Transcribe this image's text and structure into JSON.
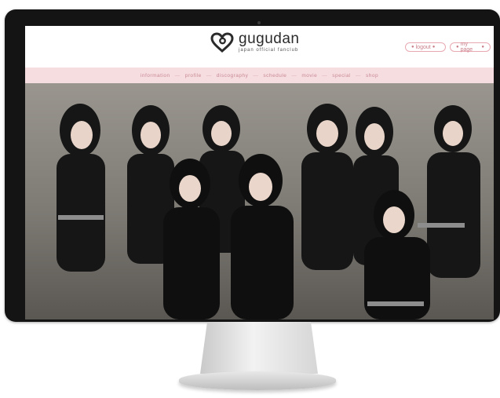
{
  "site": {
    "brand": "gugudan",
    "tagline": "japan official fanclub"
  },
  "header": {
    "logout_label": "logout",
    "mypage_label": "my page"
  },
  "nav": {
    "items": [
      "information",
      "profile",
      "discography",
      "schedule",
      "movie",
      "special",
      "shop"
    ]
  },
  "colors": {
    "accent": "#e9a9b2",
    "nav_bg": "#f6dde0",
    "nav_text": "#c88a94",
    "bezel": "#141414"
  },
  "icons": {
    "logo": "heart-logo-icon",
    "camera": "webcam-dot"
  }
}
